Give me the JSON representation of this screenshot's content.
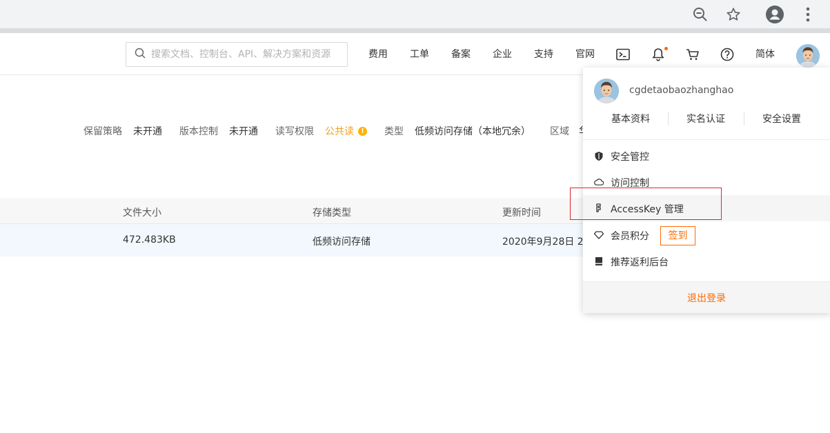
{
  "browser": {
    "icons": [
      "zoom-out-icon",
      "star-icon",
      "account-icon",
      "more-vert-icon"
    ]
  },
  "header": {
    "search_placeholder": "搜索文档、控制台、API、解决方案和资源",
    "nav": [
      "费用",
      "工单",
      "备案",
      "企业",
      "支持",
      "官网"
    ],
    "icons": [
      "terminal-icon",
      "bell-icon",
      "cart-icon",
      "help-icon"
    ],
    "lang": "简体",
    "notification_dot_color": "#ff6a00"
  },
  "bucket": {
    "retention_label": "保留策略",
    "retention_value": "未开通",
    "versioning_label": "版本控制",
    "versioning_value": "未开通",
    "acl_label": "读写权限",
    "acl_value": "公共读",
    "type_label": "类型",
    "type_value": "低频访问存储（本地冗余）",
    "region_label": "区域",
    "region_value": "华"
  },
  "table": {
    "headers": [
      "文件大小",
      "存储类型",
      "更新时间"
    ],
    "rows": [
      {
        "size": "472.483KB",
        "storage": "低频访问存储",
        "updated": "2020年9月28日 2"
      }
    ]
  },
  "dropdown": {
    "username": "cgdetaobaozhanghao",
    "links": [
      "基本资料",
      "实名认证",
      "安全设置"
    ],
    "items": [
      {
        "label": "安全管控",
        "icon": "shield-icon"
      },
      {
        "label": "访问控制",
        "icon": "cloud-icon"
      },
      {
        "label": "AccessKey 管理",
        "icon": "key-icon"
      },
      {
        "label": "会员积分",
        "icon": "diamond-icon"
      },
      {
        "label": "推荐返利后台",
        "icon": "book-icon"
      }
    ],
    "checkin": "签到",
    "logout": "退出登录",
    "accent_color": "#ff6a00"
  }
}
